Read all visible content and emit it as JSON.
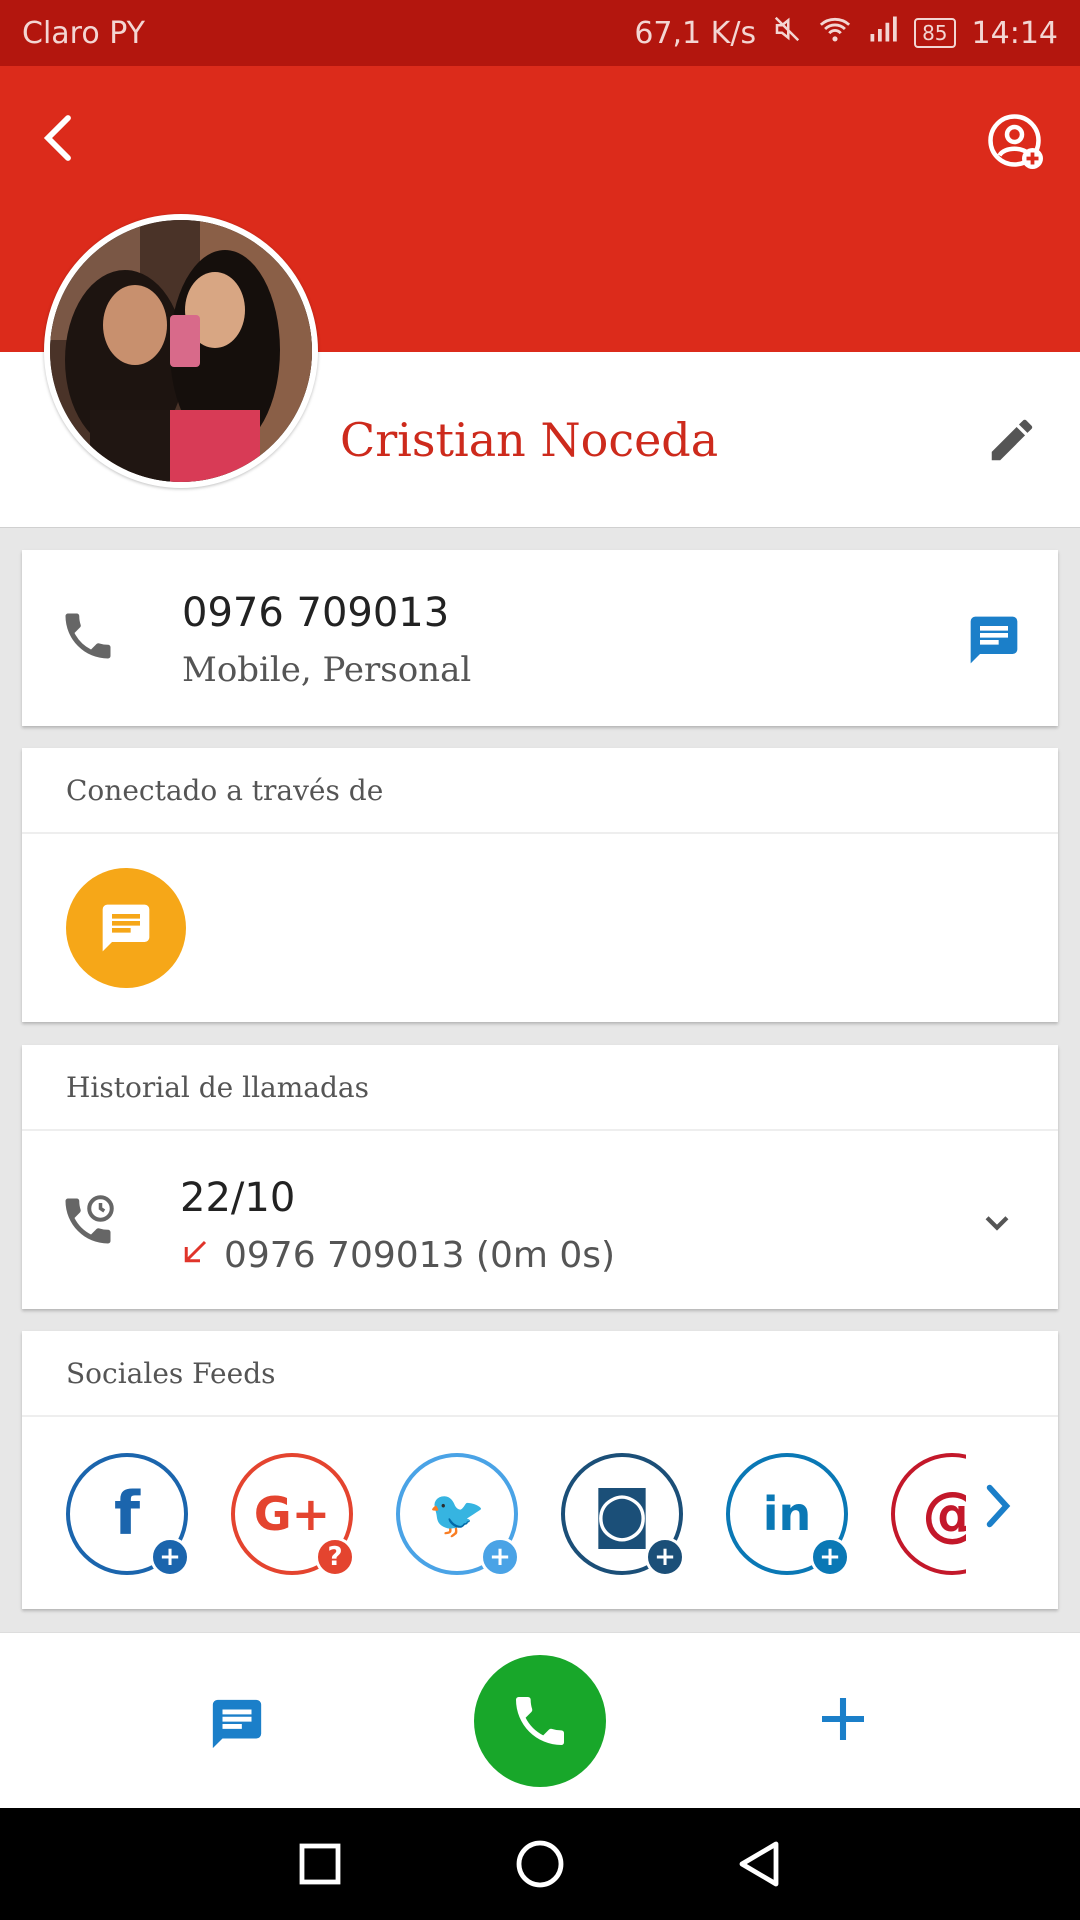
{
  "status_bar": {
    "carrier": "Claro PY",
    "speed": "67,1 K/s",
    "battery": "85",
    "time": "14:14"
  },
  "header": {
    "back_icon": "back-arrow-icon",
    "add_contact_icon": "add-contact-icon"
  },
  "contact": {
    "name": "Cristian Noceda",
    "phone": "0976 709013",
    "phone_type": "Mobile, Personal"
  },
  "connected": {
    "title": "Conectado a través de",
    "app_icon": "message-icon",
    "app_color": "#f6a718"
  },
  "history": {
    "title": "Historial de llamadas",
    "date": "22/10",
    "detail": "0976 709013 (0m 0s)"
  },
  "social": {
    "title": "Sociales Feeds",
    "items": [
      {
        "name": "Facebook",
        "glyph": "f",
        "color": "#1b65ad",
        "badge": "+"
      },
      {
        "name": "Google+",
        "glyph": "G+",
        "color": "#e4442f",
        "badge": "?"
      },
      {
        "name": "Twitter",
        "glyph": "🐦",
        "color": "#4aa3e6",
        "badge": "+"
      },
      {
        "name": "Instagram",
        "glyph": "◙",
        "color": "#1b4f78",
        "badge": "+"
      },
      {
        "name": "LinkedIn",
        "glyph": "in",
        "color": "#0a78b5",
        "badge": "+"
      },
      {
        "name": "Pinterest",
        "glyph": "@",
        "color": "#c3182a",
        "badge": ""
      }
    ]
  },
  "colors": {
    "status_bar": "#b3160e",
    "header": "#dc2b1b",
    "name": "#cd2a1c",
    "accent_blue": "#1b7fc9",
    "call_green": "#18a72a"
  }
}
